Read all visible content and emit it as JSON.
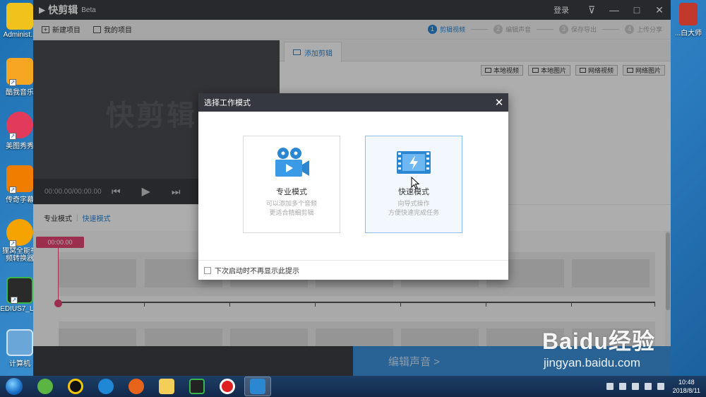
{
  "desktop": {
    "icons": [
      {
        "label": "Administ...",
        "color": "#f1c21b"
      },
      {
        "label": "酷我音乐",
        "color": "#f6a623"
      },
      {
        "label": "美图秀秀",
        "color": "#e23a5a"
      },
      {
        "label": "传奇字幕",
        "color": "#ef7d00"
      },
      {
        "label": "狸窝全能视频转换器",
        "color": "#f4a300"
      },
      {
        "label": "EDIUS7_L...",
        "color": "#2a2a2a"
      },
      {
        "label": "计算机",
        "color": "#6aa7d8"
      }
    ],
    "right_icon_label": "...白大师"
  },
  "app": {
    "title": "快剪辑",
    "beta": "Beta",
    "login": "登录",
    "toolbar": {
      "new_project": "新建项目",
      "my_projects": "我的项目"
    },
    "steps": [
      {
        "num": "1",
        "label": "剪辑视频"
      },
      {
        "num": "2",
        "label": "编辑声音"
      },
      {
        "num": "3",
        "label": "保存导出"
      },
      {
        "num": "4",
        "label": "上传分享"
      }
    ],
    "preview": {
      "watermark": "快剪辑",
      "time": "00:00.00/00:00.00"
    },
    "add_tab": "添加剪辑",
    "sources": [
      "本地视频",
      "本地图片",
      "网络视频",
      "网络图片"
    ],
    "mode_bar": {
      "pro": "专业模式",
      "quick": "快速模式"
    },
    "playhead_time": "00:00.00",
    "next_button": "编辑声音 >"
  },
  "dialog": {
    "title": "选择工作模式",
    "modes": [
      {
        "title": "专业模式",
        "desc1": "可以添加多个音频",
        "desc2": "更适合精细剪辑"
      },
      {
        "title": "快速模式",
        "desc1": "向导式操作",
        "desc2": "方便快速完成任务"
      }
    ],
    "checkbox_label": "下次启动时不再显示此提示"
  },
  "watermark": {
    "brand": "Baidu经验",
    "url": "jingyan.baidu.com"
  },
  "taskbar": {
    "time": "10:48",
    "date": "2018/8/11"
  },
  "colors": {
    "accent": "#2b87d1",
    "playhead": "#e64573",
    "titlebar": "#3a3d43"
  }
}
